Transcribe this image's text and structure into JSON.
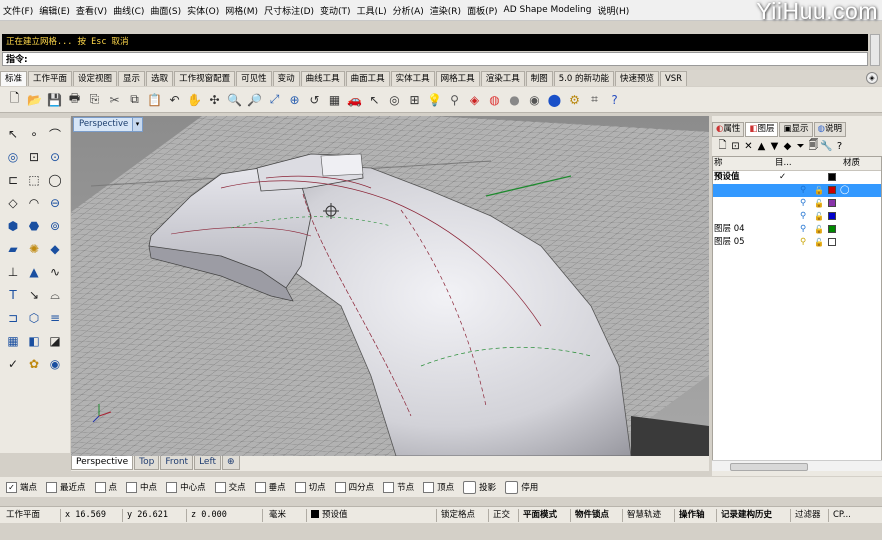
{
  "watermark": "YiiHuu.com",
  "menu": [
    "文件(F)",
    "编辑(E)",
    "查看(V)",
    "曲线(C)",
    "曲面(S)",
    "实体(O)",
    "网格(M)",
    "尺寸标注(D)",
    "变动(T)",
    "工具(L)",
    "分析(A)",
    "渲染(R)",
    "面板(P)",
    "AD Shape Modeling",
    "说明(H)"
  ],
  "command": {
    "history": "正在建立网格... 按 Esc 取消",
    "prompt": "指令:",
    "value": ""
  },
  "toolbar_tabs": [
    "标准",
    "工作平面",
    "设定视图",
    "显示",
    "选取",
    "工作视窗配置",
    "可见性",
    "变动",
    "曲线工具",
    "曲面工具",
    "实体工具",
    "网格工具",
    "渲染工具",
    "制图",
    "5.0 的新功能",
    "快速预览",
    "VSR"
  ],
  "active_toolbar_tab": "标准",
  "main_tools": [
    {
      "name": "new-icon",
      "glyph": "🗋"
    },
    {
      "name": "open-icon",
      "glyph": "📂"
    },
    {
      "name": "save-icon",
      "glyph": "💾"
    },
    {
      "name": "print-icon",
      "glyph": "🖶"
    },
    {
      "name": "import-icon",
      "glyph": "⎘"
    },
    {
      "name": "cut-icon",
      "glyph": "✂"
    },
    {
      "name": "copy-icon",
      "glyph": "⧉"
    },
    {
      "name": "paste-icon",
      "glyph": "📋"
    },
    {
      "name": "undo-icon",
      "glyph": "↶"
    },
    {
      "name": "pan-icon",
      "glyph": "✋"
    },
    {
      "name": "rotate-view-icon",
      "glyph": "✣"
    },
    {
      "name": "zoom-icon",
      "glyph": "🔍"
    },
    {
      "name": "zoom-window-icon",
      "glyph": "🔎"
    },
    {
      "name": "zoom-extents-icon",
      "glyph": "⤢"
    },
    {
      "name": "zoom-selected-icon",
      "glyph": "⊕"
    },
    {
      "name": "undo-view-icon",
      "glyph": "↺"
    },
    {
      "name": "four-view-icon",
      "glyph": "▦"
    },
    {
      "name": "car-icon",
      "glyph": "🚗"
    },
    {
      "name": "select-icon",
      "glyph": "↖"
    },
    {
      "name": "osnap-icon",
      "glyph": "◎"
    },
    {
      "name": "grid-snap-icon",
      "glyph": "⊞"
    },
    {
      "name": "light-icon",
      "glyph": "💡"
    },
    {
      "name": "bulb-icon",
      "glyph": "⚲"
    },
    {
      "name": "material-icon",
      "glyph": "◈"
    },
    {
      "name": "color-wheel-icon",
      "glyph": "◍"
    },
    {
      "name": "sphere-icon",
      "glyph": "●"
    },
    {
      "name": "render-sphere-icon",
      "glyph": "◉"
    },
    {
      "name": "blue-sphere-icon",
      "glyph": "⬤"
    },
    {
      "name": "options-icon",
      "glyph": "⚙"
    },
    {
      "name": "properties-icon",
      "glyph": "⌗"
    },
    {
      "name": "help-icon",
      "glyph": "?"
    }
  ],
  "left_tools": [
    "↖",
    "∘",
    "⌒",
    "◎",
    "⊡",
    "⊙",
    "⊏",
    "⬚",
    "◯",
    "◇",
    "◠",
    "⊖",
    "⬢",
    "⬣",
    "⊚",
    "▰",
    "✺",
    "◆",
    "⊥",
    "▲",
    "∿",
    "Τ",
    "↘",
    "⌓",
    "⊐",
    "⬡",
    "≡",
    "▦",
    "◧",
    "◪",
    "✓",
    "✿",
    "◉"
  ],
  "viewport": {
    "title": "Perspective",
    "tabs": [
      "Perspective",
      "Top",
      "Front",
      "Left"
    ],
    "active_tab": "Perspective",
    "add_tab": "⊕"
  },
  "panel": {
    "tabs": [
      "属性",
      "图层",
      "显示",
      "说明"
    ],
    "active_tab": "图层",
    "columns": {
      "name": "称",
      "current": "目...",
      "material": "材质"
    },
    "layers": [
      {
        "name": "预设值",
        "current": "✓",
        "bold": true,
        "selected": false,
        "color": "#000000",
        "show_icons": false
      },
      {
        "name": "",
        "current": "",
        "bold": false,
        "selected": true,
        "color": "#cc0000",
        "show_icons": true
      },
      {
        "name": "",
        "current": "",
        "bold": false,
        "selected": false,
        "color": "#8833aa",
        "show_icons": true
      },
      {
        "name": "",
        "current": "",
        "bold": false,
        "selected": false,
        "color": "#0000cc",
        "show_icons": true
      },
      {
        "name": "图层 04",
        "current": "",
        "bold": false,
        "selected": false,
        "color": "#008800",
        "show_icons": true
      },
      {
        "name": "图层 05",
        "current": "",
        "bold": false,
        "selected": false,
        "color": "#ffffff",
        "show_icons": true
      }
    ]
  },
  "osnaps": [
    {
      "label": "端点",
      "checked": true
    },
    {
      "label": "最近点",
      "checked": false
    },
    {
      "label": "点",
      "checked": false
    },
    {
      "label": "中点",
      "checked": false
    },
    {
      "label": "中心点",
      "checked": false
    },
    {
      "label": "交点",
      "checked": false
    },
    {
      "label": "垂点",
      "checked": false
    },
    {
      "label": "切点",
      "checked": false
    },
    {
      "label": "四分点",
      "checked": false
    },
    {
      "label": "节点",
      "checked": false
    },
    {
      "label": "顶点",
      "checked": false
    }
  ],
  "osnap_toggles": [
    "投影",
    "停用"
  ],
  "status": {
    "cplane": "工作平面",
    "x": "x 16.569",
    "y": "y 26.621",
    "z": "z 0.000",
    "units": "毫米",
    "layer": "预设值",
    "grid_snap": "锁定格点",
    "ortho": "正交",
    "planar": "平面模式",
    "osnap": "物件锁点",
    "smarttrack": "智慧轨迹",
    "gumball": "操作轴",
    "history": "记录建构历史",
    "filter": "过滤器",
    "cpu": "CP..."
  }
}
